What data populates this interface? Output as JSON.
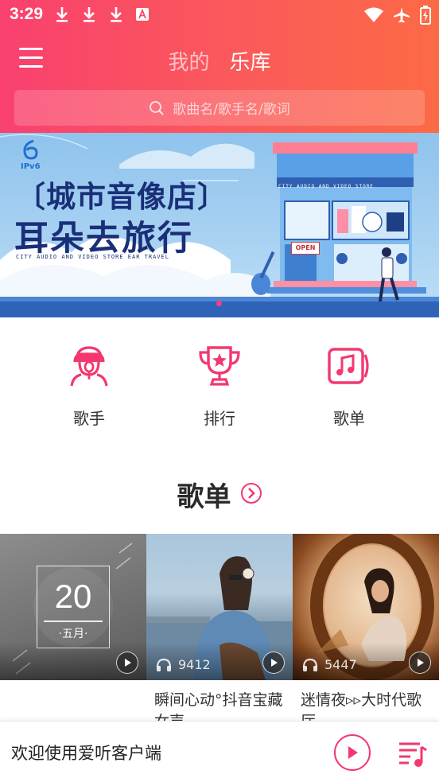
{
  "status_bar": {
    "time": "3:29",
    "left_icons": [
      "download-icon",
      "download-icon",
      "download-icon",
      "a-icon"
    ],
    "right_icons": [
      "wifi-icon",
      "airplane-icon",
      "battery-charging-icon"
    ]
  },
  "header": {
    "tabs": [
      {
        "label": "我的",
        "active": false
      },
      {
        "label": "乐库",
        "active": true
      }
    ]
  },
  "search": {
    "placeholder": "歌曲名/歌手名/歌词"
  },
  "banner": {
    "logo_text": "IPv6",
    "title_line1": "〔城市音像店〕",
    "title_line2": "耳朵去旅行",
    "subtitle": "CITY AUDIO AND VIDEO STORE  EAR TRAVEL",
    "store_sign": "CITY AUDIO AND VIDEO STORE",
    "open_sign": "OPEN",
    "active_dot": 0
  },
  "categories": [
    {
      "label": "歌手",
      "icon": "singer-icon"
    },
    {
      "label": "排行",
      "icon": "trophy-icon"
    },
    {
      "label": "歌单",
      "icon": "playlist-note-icon"
    }
  ],
  "section": {
    "title": "歌单",
    "more_icon": "chevron-right-circle-icon"
  },
  "playlists": [
    {
      "date_day": "20",
      "date_month": "·五月·",
      "name": "",
      "plays": ""
    },
    {
      "date_day": "",
      "date_month": "",
      "name": "瞬间心动°抖音宝藏女声",
      "plays": "9412"
    },
    {
      "date_day": "",
      "date_month": "",
      "name": "迷情夜▹▹大时代歌厅",
      "plays": "5447"
    }
  ],
  "player": {
    "text": "欢迎使用爱听客户端"
  },
  "colors": {
    "accent": "#f3386f",
    "gradient_start": "#f9406f",
    "gradient_end": "#fc6a45"
  }
}
